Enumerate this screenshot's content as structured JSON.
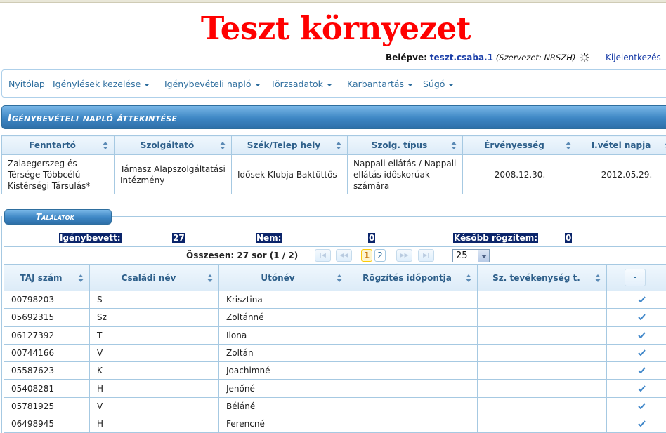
{
  "env_title": "Teszt környezet",
  "login": {
    "label": "Belépve:",
    "user": "teszt.csaba.1",
    "org": "(Szervezet: NRSZH)",
    "logout": "Kijelentkezés"
  },
  "menu": [
    {
      "label": "Nyitólap",
      "dropdown": false
    },
    {
      "label": "Igénylések kezelése",
      "dropdown": true
    },
    {
      "label": "Igénybevételi napló",
      "dropdown": true
    },
    {
      "label": "Törzsadatok",
      "dropdown": true
    },
    {
      "label": "Karbantartás",
      "dropdown": true
    },
    {
      "label": "Súgó",
      "dropdown": true
    }
  ],
  "section_title": "Igénybevételi napló áttekintése",
  "summary": {
    "headers": [
      "Fenntartó",
      "Szolgáltató",
      "Szék/Telep hely",
      "Szolg. típus",
      "Érvényesség",
      "I.vétel napja"
    ],
    "row": [
      "Zalaegerszeg és Térsége Többcélú Kistérségi Társulás*",
      "Támasz Alapszolgáltatási Intézmény",
      "Idősek Klubja Baktüttős",
      "Nappali ellátás / Nappali ellátás időskorúak számára",
      "2008.12.30.",
      "2012.05.29."
    ]
  },
  "results": {
    "tab_label": "Találatok",
    "stats": [
      {
        "label": "Igénybevett:",
        "value": "27"
      },
      {
        "label": "Nem:",
        "value": "0"
      },
      {
        "label": "Később rögzítem:",
        "value": "0"
      }
    ],
    "pager": {
      "summary": "Összesen: 27 sor (1 / 2)",
      "pages": [
        "1",
        "2"
      ],
      "current_page": "1",
      "page_size": "25",
      "first": "|◀",
      "prev": "◀◀",
      "next": "▶▶",
      "last": "▶|"
    },
    "columns": [
      "TAJ szám",
      "Családi név",
      "Utónév",
      "Rögzítés időpontja",
      "Sz. tevékenység t.",
      "-"
    ],
    "rows": [
      {
        "taj": "00798203",
        "family": "S",
        "given": "Krisztina",
        "time": "",
        "activity": ""
      },
      {
        "taj": "05692315",
        "family": "Sz",
        "given": "Zoltánné",
        "time": "",
        "activity": ""
      },
      {
        "taj": "06127392",
        "family": "T",
        "given": "Ilona",
        "time": "",
        "activity": ""
      },
      {
        "taj": "00744166",
        "family": "V",
        "given": "Zoltán",
        "time": "",
        "activity": ""
      },
      {
        "taj": "05587623",
        "family": "K",
        "given": "Joachimné",
        "time": "",
        "activity": ""
      },
      {
        "taj": "05408281",
        "family": "H",
        "given": "Jenőné",
        "time": "",
        "activity": ""
      },
      {
        "taj": "05781925",
        "family": "V",
        "given": "Béláné",
        "time": "",
        "activity": ""
      },
      {
        "taj": "06498945",
        "family": "H",
        "given": "Ferencné",
        "time": "",
        "activity": ""
      }
    ]
  },
  "colors": {
    "env_title": "#ff0000",
    "accent": "#2e6e9e",
    "header_blue": "#3d86c4",
    "highlight": "#0a246a"
  }
}
